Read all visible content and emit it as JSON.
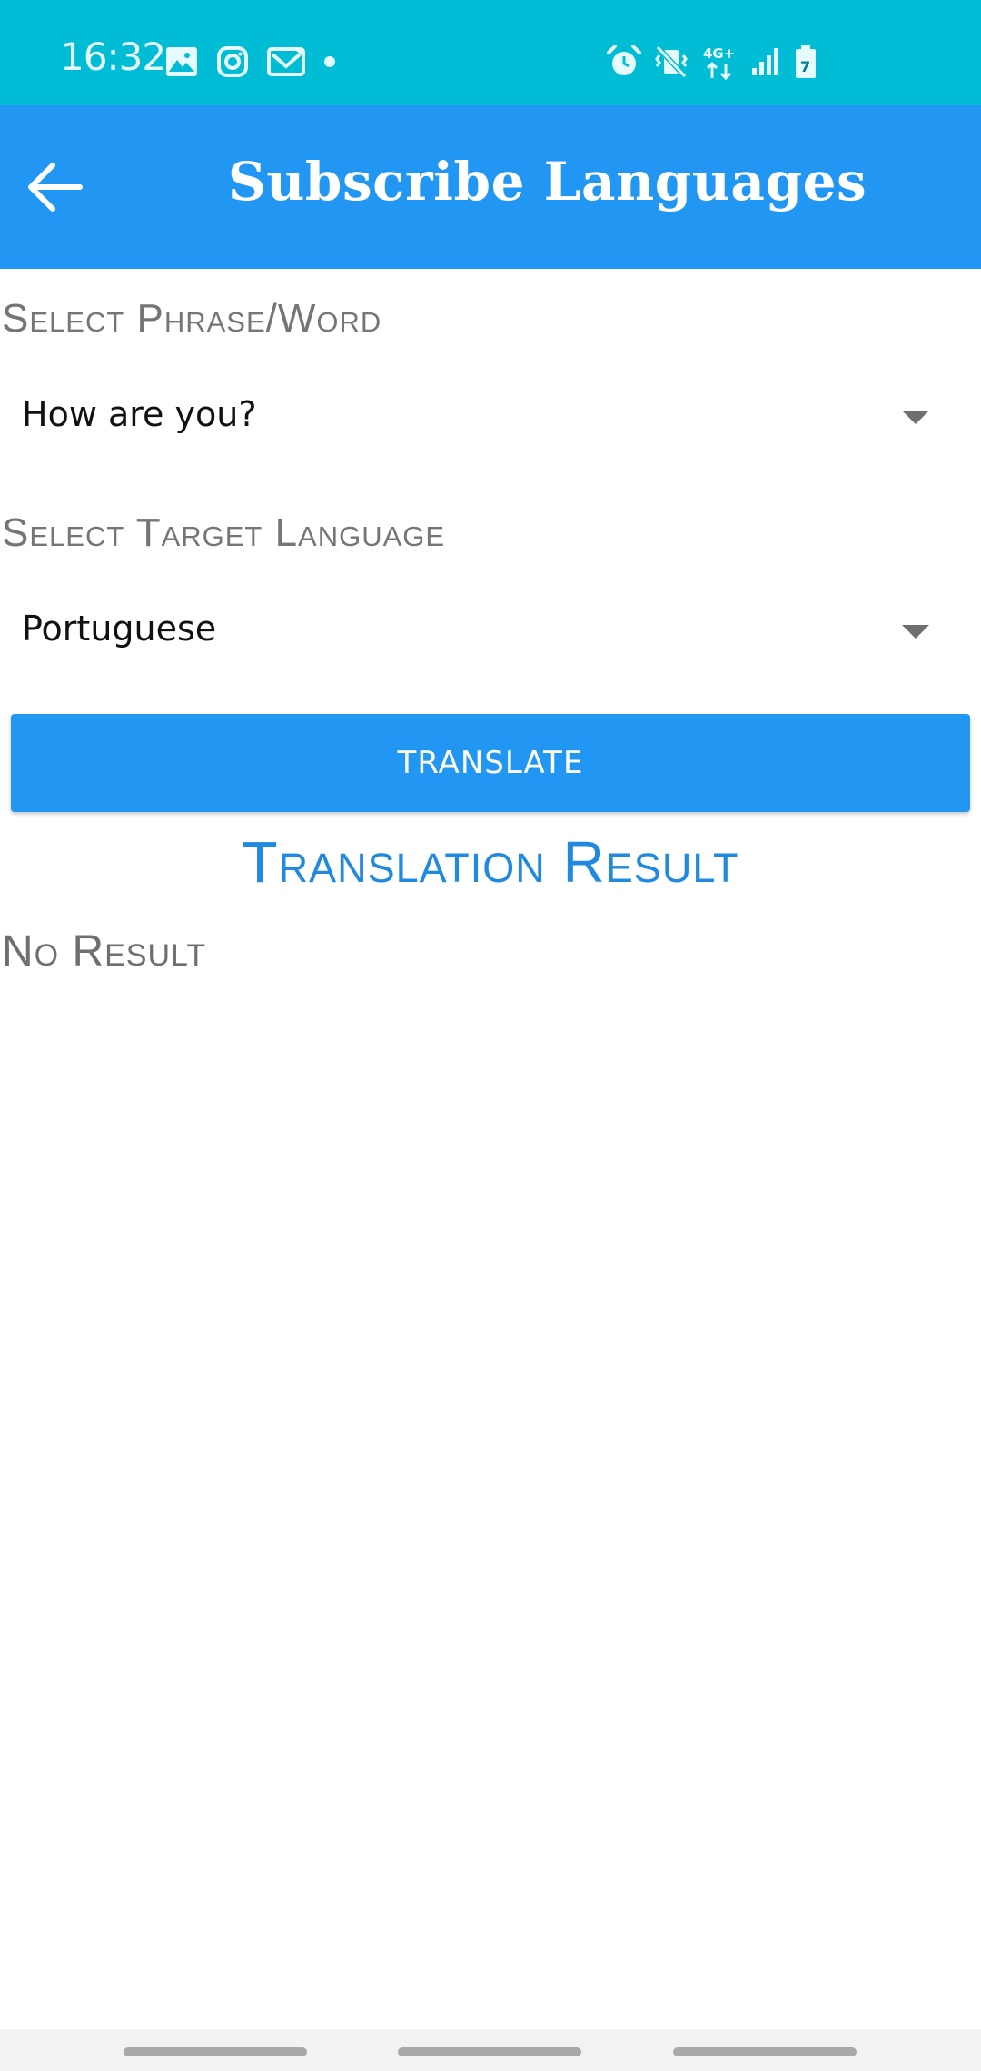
{
  "status_bar": {
    "time": "16:32",
    "network": "4G+",
    "battery_level": "7",
    "left_icons": [
      "gallery-icon",
      "instagram-icon",
      "mail-icon",
      "notification-dot-icon"
    ],
    "right_icons": [
      "alarm-icon",
      "vibrate-mute-icon",
      "network-4g-icon",
      "signal-icon",
      "battery-icon"
    ],
    "color": "#00bcd4"
  },
  "app_bar": {
    "title": "Subscribe Languages",
    "back_icon": "arrow-left-icon",
    "color": "#2196f3"
  },
  "form": {
    "phrase_label": "Select Phrase/Word",
    "phrase_value": "How are you?",
    "language_label": "Select Target Language",
    "language_value": "Portuguese",
    "translate_button": "TRANSLATE"
  },
  "result": {
    "title": "Translation Result",
    "text": "No Result"
  },
  "colors": {
    "accent": "#2196f3",
    "result_title": "#2189e0",
    "label_gray": "#757575"
  }
}
